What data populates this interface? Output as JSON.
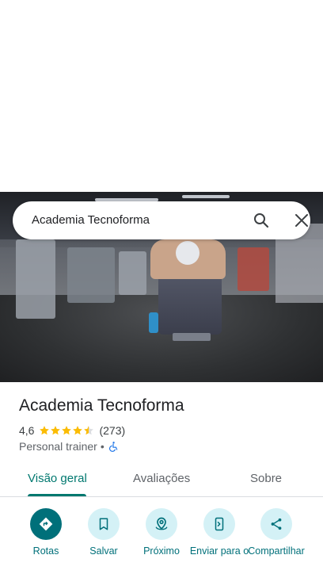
{
  "search": {
    "query": "Academia Tecnoforma"
  },
  "place": {
    "name": "Academia Tecnoforma",
    "rating": "4,6",
    "stars": 4.5,
    "review_count": "(273)",
    "category": "Personal trainer",
    "separator": "•"
  },
  "tabs": [
    {
      "label": "Visão geral",
      "active": true
    },
    {
      "label": "Avaliações",
      "active": false
    },
    {
      "label": "Sobre",
      "active": false
    }
  ],
  "actions": [
    {
      "label": "Rotas",
      "icon": "directions-icon"
    },
    {
      "label": "Salvar",
      "icon": "bookmark-icon"
    },
    {
      "label": "Próximo",
      "icon": "nearby-icon"
    },
    {
      "label": "Enviar para o",
      "icon": "send-to-phone-icon"
    },
    {
      "label": "Compartilhar",
      "icon": "share-icon"
    }
  ],
  "colors": {
    "accent": "#00707a",
    "star": "#fbbc04",
    "chip_bg": "#d4f1f6"
  }
}
